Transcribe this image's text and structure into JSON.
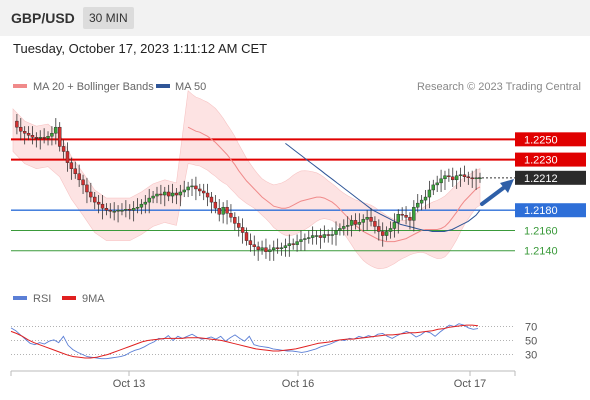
{
  "header": {
    "pair": "GBP/USD",
    "timeframe": "30 MIN"
  },
  "datetime": "Tuesday, October 17, 2023 1:11:12 AM CET",
  "legend_main": [
    {
      "label": "MA 20 + Bollinger Bands",
      "color": "#f08a8a"
    },
    {
      "label": "MA 50",
      "color": "#2f5597"
    }
  ],
  "credit": "Research © 2023 Trading Central",
  "legend_rsi": [
    {
      "label": "RSI",
      "color": "#5b7fd6"
    },
    {
      "label": "9MA",
      "color": "#e02020"
    }
  ],
  "colors": {
    "resistance": "#e00000",
    "support": "#2e6fd8",
    "support_minor": "#3a9a3a",
    "up_candle": "#3aa03a",
    "down_candle": "#d23030",
    "band_fill": "#fde3e3"
  },
  "chart_data": [
    {
      "type": "candlestick",
      "x_ticks": [
        "Oct 13",
        "Oct 16",
        "Oct 17"
      ],
      "ylim": [
        1.2119,
        1.2276
      ],
      "levels": [
        {
          "value": "1.2250",
          "kind": "resistance"
        },
        {
          "value": "1.2230",
          "kind": "resistance"
        },
        {
          "value": "1.2212",
          "kind": "last"
        },
        {
          "value": "1.2180",
          "kind": "support"
        },
        {
          "value": "1.2160",
          "kind": "support_minor"
        },
        {
          "value": "1.2140",
          "kind": "support_minor"
        }
      ],
      "close": [
        1.2268,
        1.2262,
        1.2258,
        1.2256,
        1.2254,
        1.2252,
        1.2251,
        1.2252,
        1.2251,
        1.2253,
        1.2256,
        1.2262,
        1.2243,
        1.2238,
        1.2227,
        1.2221,
        1.2216,
        1.221,
        1.2205,
        1.2198,
        1.2193,
        1.2188,
        1.2186,
        1.2182,
        1.218,
        1.2179,
        1.2179,
        1.218,
        1.218,
        1.2181,
        1.218,
        1.2182,
        1.2183,
        1.2186,
        1.2188,
        1.2192,
        1.2194,
        1.2196,
        1.2195,
        1.2198,
        1.2194,
        1.2197,
        1.2195,
        1.2198,
        1.22,
        1.2203,
        1.2204,
        1.2201,
        1.2199,
        1.2197,
        1.2193,
        1.2188,
        1.2182,
        1.2176,
        1.2183,
        1.2177,
        1.2173,
        1.2167,
        1.2163,
        1.2158,
        1.215,
        1.2146,
        1.2144,
        1.2141,
        1.2143,
        1.2139,
        1.2141,
        1.2143,
        1.2142,
        1.2143,
        1.2145,
        1.2147,
        1.2146,
        1.2149,
        1.2151,
        1.2152,
        1.2153,
        1.2155,
        1.2155,
        1.2153,
        1.2156,
        1.2155,
        1.2156,
        1.216,
        1.2162,
        1.2164,
        1.2165,
        1.217,
        1.2166,
        1.2168,
        1.2171,
        1.2173,
        1.2169,
        1.2164,
        1.2159,
        1.2155,
        1.2159,
        1.2162,
        1.2168,
        1.2176,
        1.2175,
        1.2173,
        1.217,
        1.2183,
        1.2187,
        1.219,
        1.2193,
        1.22,
        1.2205,
        1.2207,
        1.2211,
        1.2214,
        1.2213,
        1.221,
        1.2214,
        1.2215,
        1.2213,
        1.2212,
        1.2211,
        1.2212,
        1.2212
      ],
      "ma20": [
        1.2262,
        1.226,
        1.2258,
        1.2257,
        1.2255,
        1.2253,
        1.225,
        1.2247,
        1.2243,
        1.2239,
        1.2235,
        1.223,
        1.2225,
        1.2219,
        1.2214,
        1.2209,
        1.2205,
        1.2201,
        1.2197,
        1.2193,
        1.219,
        1.2187,
        1.2184,
        1.2183,
        1.2182,
        1.2182,
        1.2183,
        1.2185,
        1.2187,
        1.2189,
        1.219,
        1.2191,
        1.2192,
        1.2193,
        1.2193,
        1.2192,
        1.219,
        1.2188,
        1.2185,
        1.2181,
        1.2177,
        1.2173,
        1.2169,
        1.2165,
        1.2162,
        1.2159,
        1.2157,
        1.2155,
        1.2153,
        1.2151,
        1.215,
        1.2149,
        1.2149,
        1.2149,
        1.215,
        1.2151,
        1.2152,
        1.2154,
        1.2156,
        1.2158,
        1.216,
        1.2161,
        1.2161,
        1.2161,
        1.2161,
        1.2162,
        1.2164,
        1.2168,
        1.2173,
        1.2178,
        1.2184,
        1.2189,
        1.2193,
        1.2197,
        1.2201,
        1.2203
      ],
      "ma20_x0": 45,
      "ma50": [
        1.2246,
        1.2243,
        1.224,
        1.2237,
        1.2234,
        1.2231,
        1.2228,
        1.2225,
        1.2222,
        1.2219,
        1.2216,
        1.2213,
        1.221,
        1.2207,
        1.2204,
        1.2201,
        1.2198,
        1.2195,
        1.2192,
        1.2189,
        1.2186,
        1.2183,
        1.218,
        1.2178,
        1.2176,
        1.2174,
        1.2172,
        1.217,
        1.2168,
        1.2166,
        1.2165,
        1.2164,
        1.2163,
        1.2162,
        1.2161,
        1.216,
        1.216,
        1.2159,
        1.2159,
        1.2159,
        1.2159,
        1.216,
        1.2161,
        1.2163,
        1.2165,
        1.2167,
        1.2169,
        1.2172,
        1.2175,
        1.218
      ],
      "ma50_x0": 70
    },
    {
      "type": "line",
      "name": "RSI",
      "y_ticks": [
        "70",
        "50",
        "30"
      ],
      "ylim": [
        15,
        85
      ],
      "rsi": [
        68,
        64,
        58,
        52,
        46,
        44,
        47,
        45,
        49,
        51,
        47,
        56,
        43,
        37,
        33,
        30,
        27,
        26,
        25,
        24,
        24,
        25,
        26,
        27,
        29,
        33,
        36,
        38,
        41,
        45,
        48,
        53,
        52,
        57,
        50,
        56,
        53,
        56,
        59,
        55,
        52,
        53,
        55,
        52,
        56,
        49,
        54,
        58,
        53,
        49,
        56,
        44,
        42,
        41,
        40,
        38,
        37,
        36,
        35,
        35,
        34,
        33,
        34,
        36,
        38,
        41,
        43,
        45,
        48,
        51,
        50,
        53,
        52,
        56,
        54,
        57,
        55,
        59,
        60,
        56,
        53,
        57,
        60,
        63,
        60,
        55,
        58,
        63,
        61,
        56,
        62,
        67,
        72,
        70,
        74,
        72,
        68,
        66,
        67
      ],
      "ma9": [
        63,
        60,
        56,
        51,
        47,
        44,
        41,
        38,
        35,
        32,
        29,
        27,
        26,
        25,
        25,
        26,
        28,
        30,
        33,
        36,
        39,
        42,
        45,
        48,
        50,
        51,
        52,
        53,
        53,
        53,
        53,
        54,
        54,
        54,
        53,
        52,
        51,
        50,
        48,
        46,
        44,
        42,
        40,
        38,
        37,
        36,
        35,
        35,
        36,
        37,
        38,
        40,
        42,
        44,
        46,
        47,
        48,
        50,
        51,
        52,
        52,
        53,
        54,
        55,
        56,
        57,
        58,
        58,
        59,
        60,
        61,
        61,
        62,
        63,
        64,
        66,
        67,
        69,
        70,
        71,
        72,
        72,
        71
      ]
    }
  ]
}
